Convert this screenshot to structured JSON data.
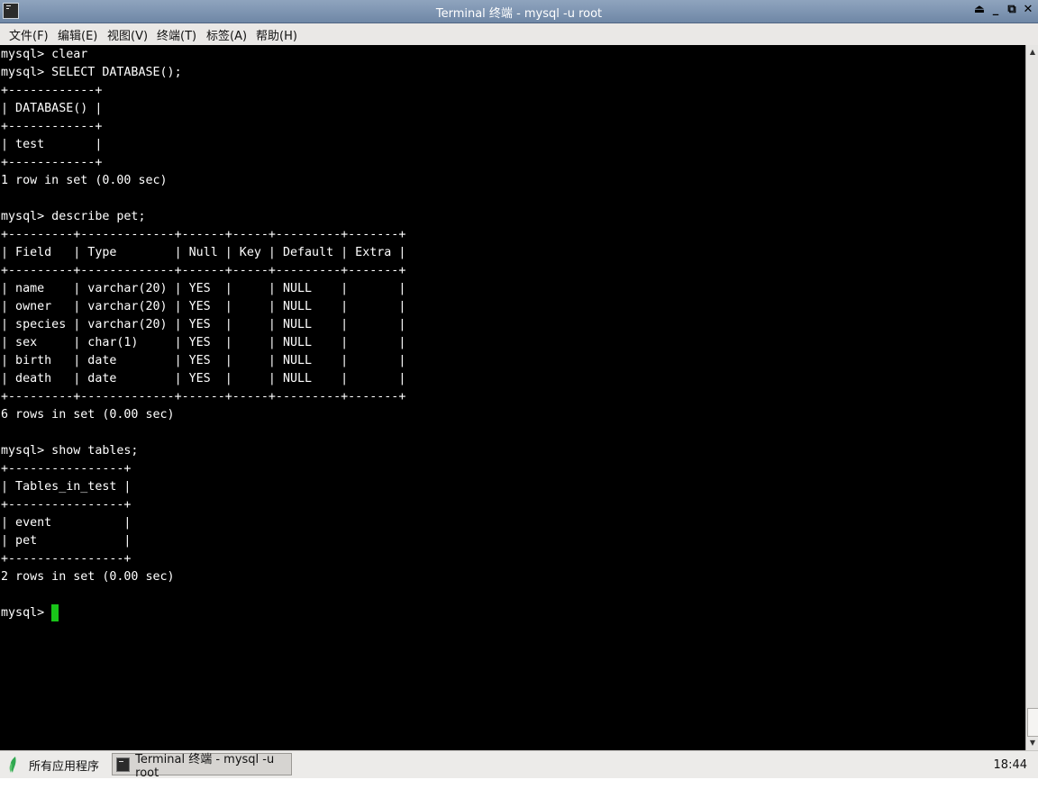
{
  "window": {
    "title": "Terminal 终端 - mysql -u root"
  },
  "menu": {
    "items": [
      "文件(F)",
      "编辑(E)",
      "视图(V)",
      "终端(T)",
      "标签(A)",
      "帮助(H)"
    ]
  },
  "terminal": {
    "lines": [
      "mysql> clear",
      "mysql> SELECT DATABASE();",
      "+------------+",
      "| DATABASE() |",
      "+------------+",
      "| test       |",
      "+------------+",
      "1 row in set (0.00 sec)",
      "",
      "mysql> describe pet;",
      "+---------+-------------+------+-----+---------+-------+",
      "| Field   | Type        | Null | Key | Default | Extra |",
      "+---------+-------------+------+-----+---------+-------+",
      "| name    | varchar(20) | YES  |     | NULL    |       |",
      "| owner   | varchar(20) | YES  |     | NULL    |       |",
      "| species | varchar(20) | YES  |     | NULL    |       |",
      "| sex     | char(1)     | YES  |     | NULL    |       |",
      "| birth   | date        | YES  |     | NULL    |       |",
      "| death   | date        | YES  |     | NULL    |       |",
      "+---------+-------------+------+-----+---------+-------+",
      "6 rows in set (0.00 sec)",
      "",
      "mysql> show tables;",
      "+----------------+",
      "| Tables_in_test |",
      "+----------------+",
      "| event          |",
      "| pet            |",
      "+----------------+",
      "2 rows in set (0.00 sec)",
      "",
      "mysql> "
    ]
  },
  "colors": {
    "cursor": "#19c519",
    "terminal_bg": "#000000",
    "terminal_fg": "#ffffff"
  },
  "taskbar": {
    "start_label": "所有应用程序",
    "task_label": "Terminal 终端 - mysql -u root",
    "clock": "18:44"
  }
}
